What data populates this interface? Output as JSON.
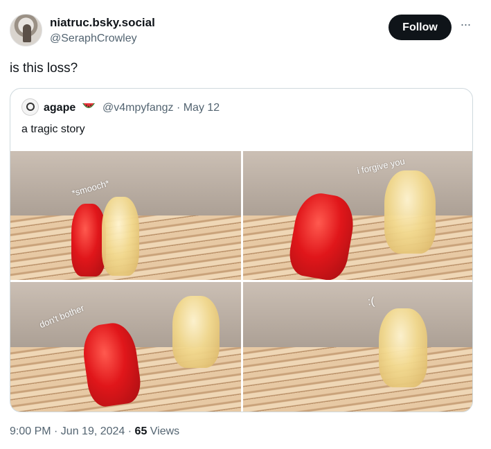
{
  "author": {
    "display_name": "niatruc.bsky.social",
    "handle": "@SeraphCrowley"
  },
  "actions": {
    "follow_label": "Follow",
    "more_label": "···"
  },
  "tweet": {
    "text": "is this loss?"
  },
  "quoted_tweet": {
    "display_name": "agape",
    "emoji_icon": "watermelon-icon",
    "meta": "@v4mpyfangz · May 12",
    "text": "a tragic story",
    "captions": [
      "*smooch*",
      "i forgive you",
      "don't bother",
      ":("
    ]
  },
  "footer": {
    "time_date": "9:00 PM · Jun 19, 2024 · ",
    "views_count": "65",
    "views_label": " Views"
  },
  "colors": {
    "primary_text": "#0f1419",
    "secondary_text": "#536471",
    "border": "#cfd9de",
    "follow_button_bg": "#0f1419"
  }
}
